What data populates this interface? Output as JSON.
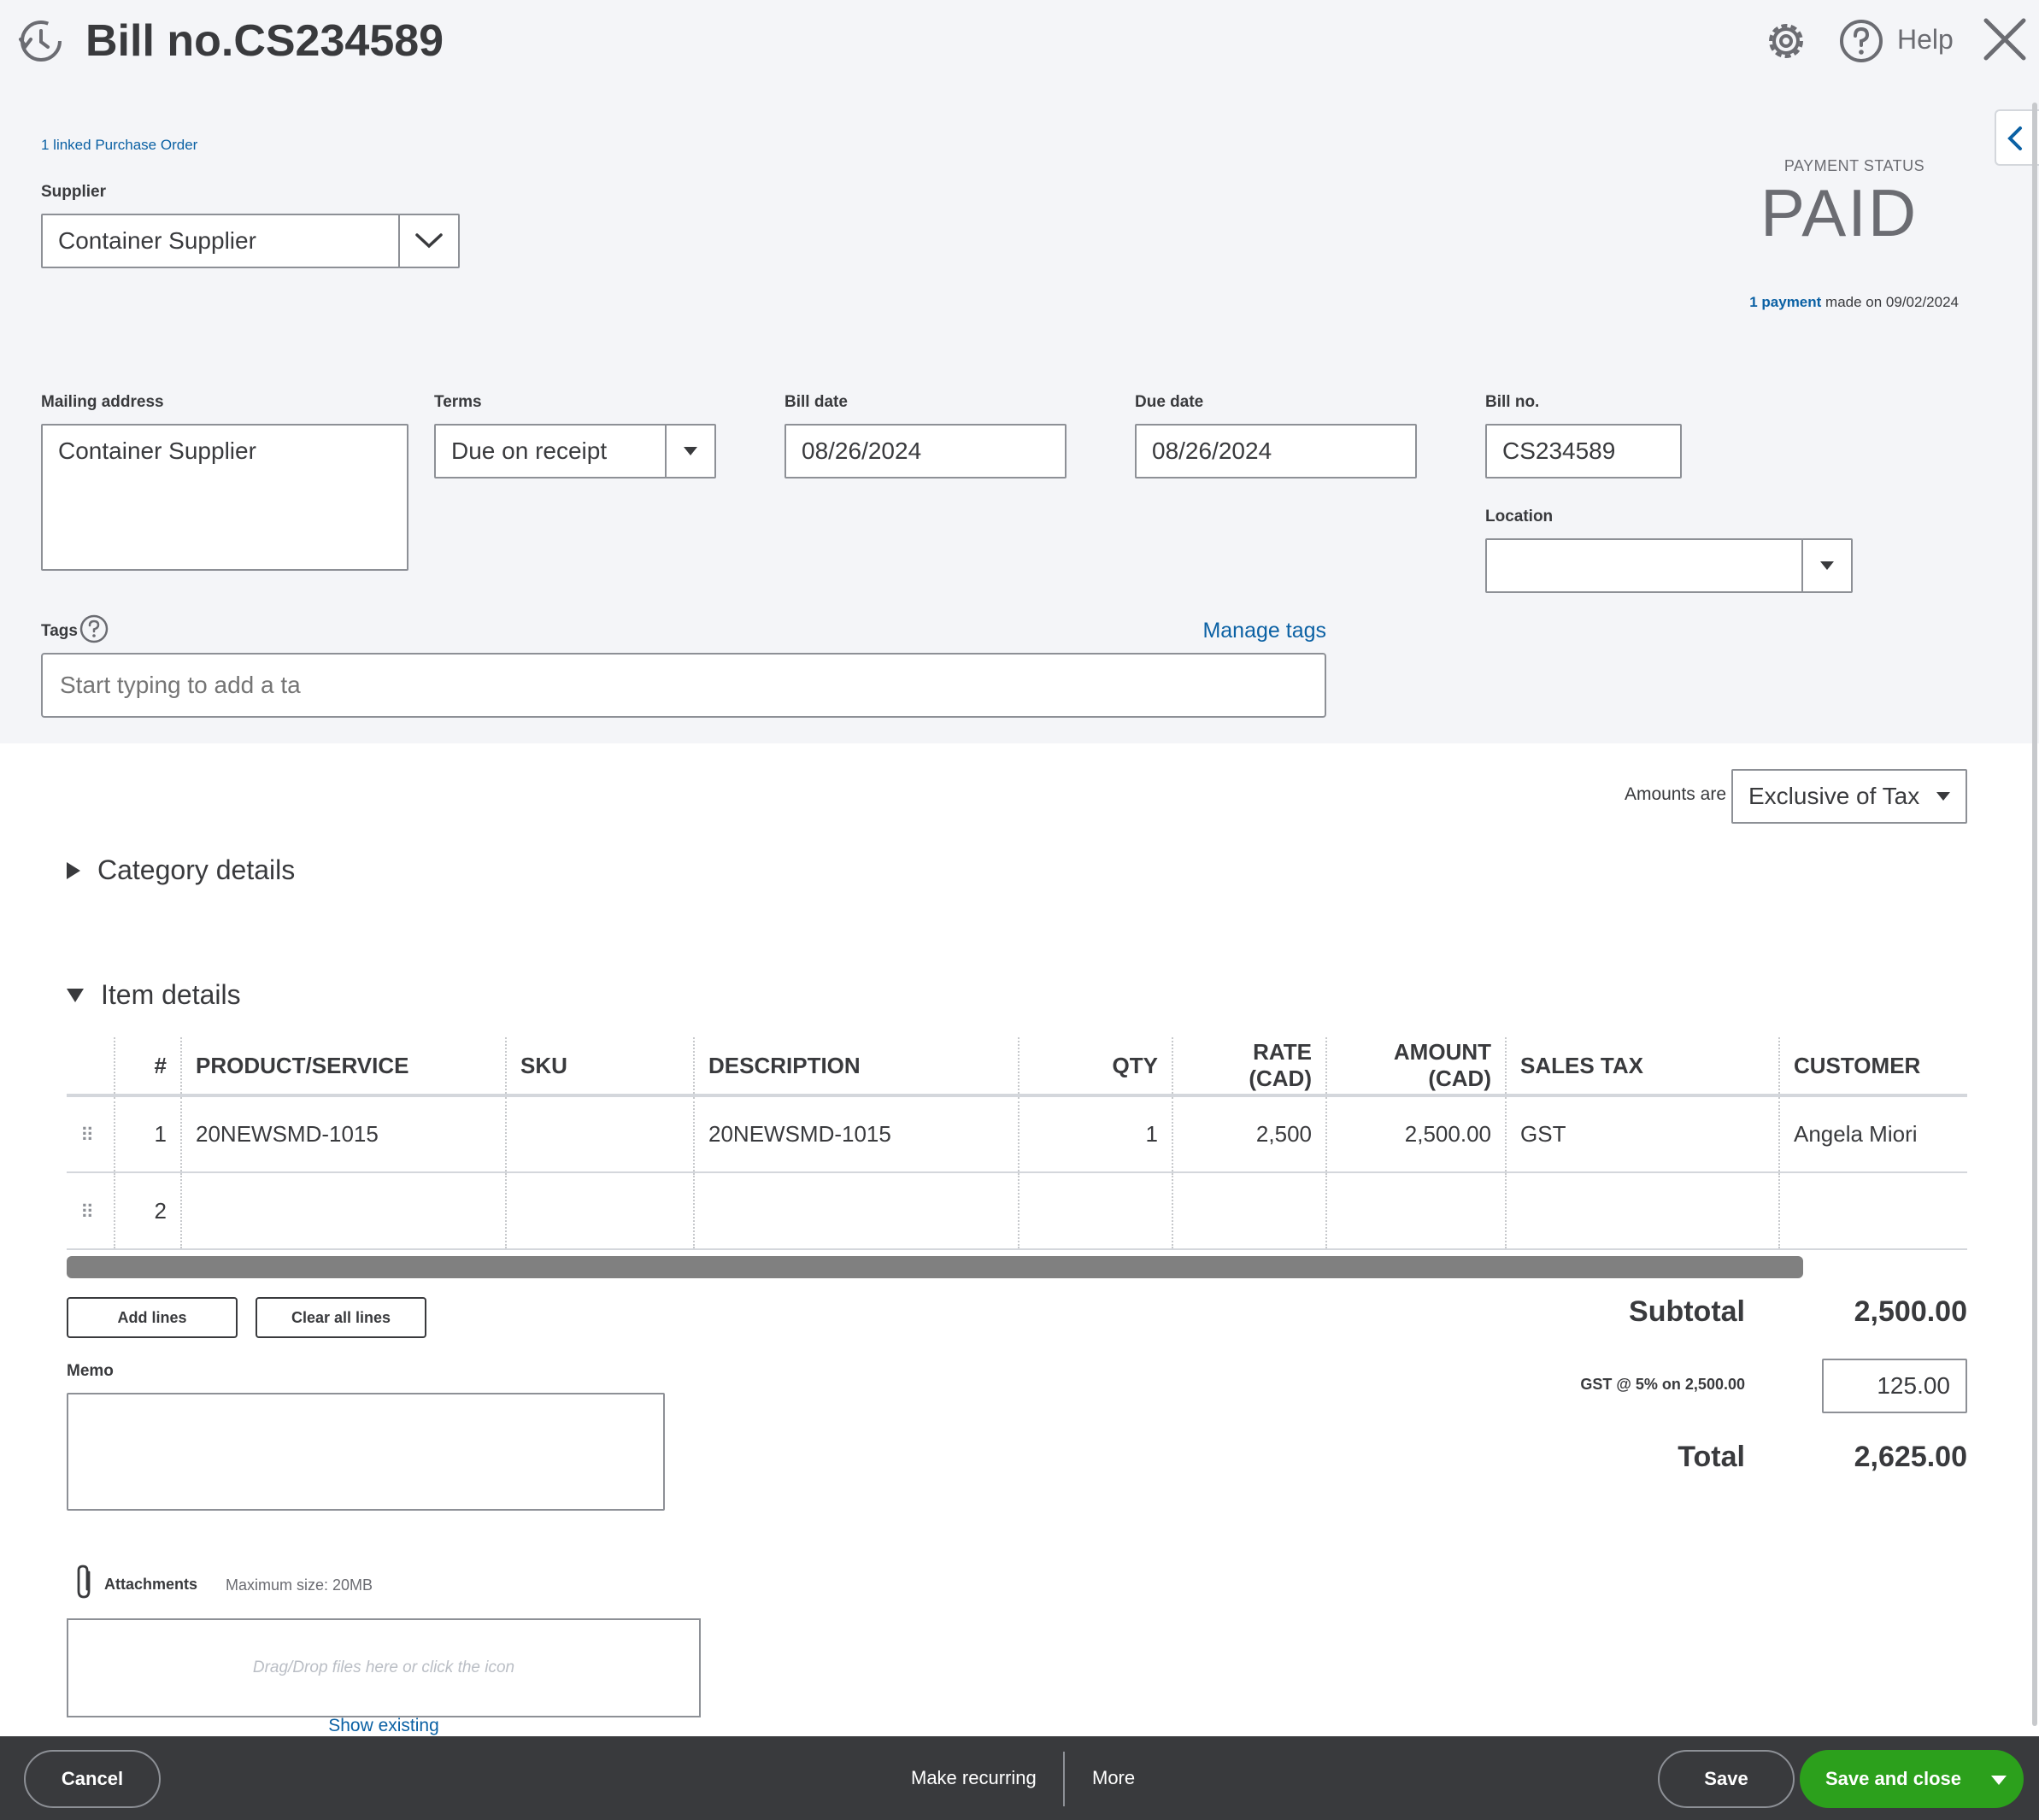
{
  "header": {
    "title": "Bill no.CS234589",
    "help_label": "Help"
  },
  "linked": {
    "purchase_order_link": "1 linked Purchase Order"
  },
  "supplier": {
    "label": "Supplier",
    "value": "Container Supplier"
  },
  "payment_status": {
    "label": "PAYMENT STATUS",
    "value": "PAID",
    "payment_link": "1 payment",
    "made_on": " made on 09/02/2024"
  },
  "mailing_address": {
    "label": "Mailing address",
    "value": "Container Supplier"
  },
  "terms": {
    "label": "Terms",
    "value": "Due on receipt"
  },
  "bill_date": {
    "label": "Bill date",
    "value": "08/26/2024"
  },
  "due_date": {
    "label": "Due date",
    "value": "08/26/2024"
  },
  "bill_no": {
    "label": "Bill no.",
    "value": "CS234589"
  },
  "location": {
    "label": "Location",
    "value": ""
  },
  "tags": {
    "label": "Tags",
    "manage_link": "Manage tags",
    "placeholder": "Start typing to add a ta"
  },
  "amounts": {
    "label": "Amounts are",
    "value": "Exclusive of Tax"
  },
  "sections": {
    "category_details": "Category details",
    "item_details": "Item details"
  },
  "table": {
    "headers": [
      "#",
      "PRODUCT/SERVICE",
      "SKU",
      "DESCRIPTION",
      "QTY",
      "RATE (CAD)",
      "AMOUNT (CAD)",
      "SALES TAX",
      "CUSTOMER"
    ],
    "rows": [
      {
        "num": "1",
        "product": "20NEWSMD-1015",
        "sku": "",
        "description": "20NEWSMD-1015",
        "qty": "1",
        "rate": "2,500",
        "amount": "2,500.00",
        "tax": "GST",
        "customer": "Angela Miori"
      },
      {
        "num": "2",
        "product": "",
        "sku": "",
        "description": "",
        "qty": "",
        "rate": "",
        "amount": "",
        "tax": "",
        "customer": ""
      }
    ]
  },
  "line_buttons": {
    "add_lines": "Add lines",
    "clear_all_lines": "Clear all lines"
  },
  "totals": {
    "subtotal_label": "Subtotal",
    "subtotal_value": "2,500.00",
    "gst_label": "GST @ 5% on 2,500.00",
    "gst_value": "125.00",
    "total_label": "Total",
    "total_value": "2,625.00"
  },
  "memo": {
    "label": "Memo",
    "value": ""
  },
  "attachments": {
    "label": "Attachments",
    "max_size": "Maximum size: 20MB",
    "drop_text": "Drag/Drop files here or click the icon",
    "show_existing": "Show existing"
  },
  "footer": {
    "cancel": "Cancel",
    "make_recurring": "Make recurring",
    "more": "More",
    "save": "Save",
    "save_and_close": "Save and close"
  },
  "colors": {
    "primary_green": "#2ca01c",
    "link_blue": "#0b61a4",
    "footer_bg": "#393a3d",
    "header_bg": "#f4f5f8"
  }
}
